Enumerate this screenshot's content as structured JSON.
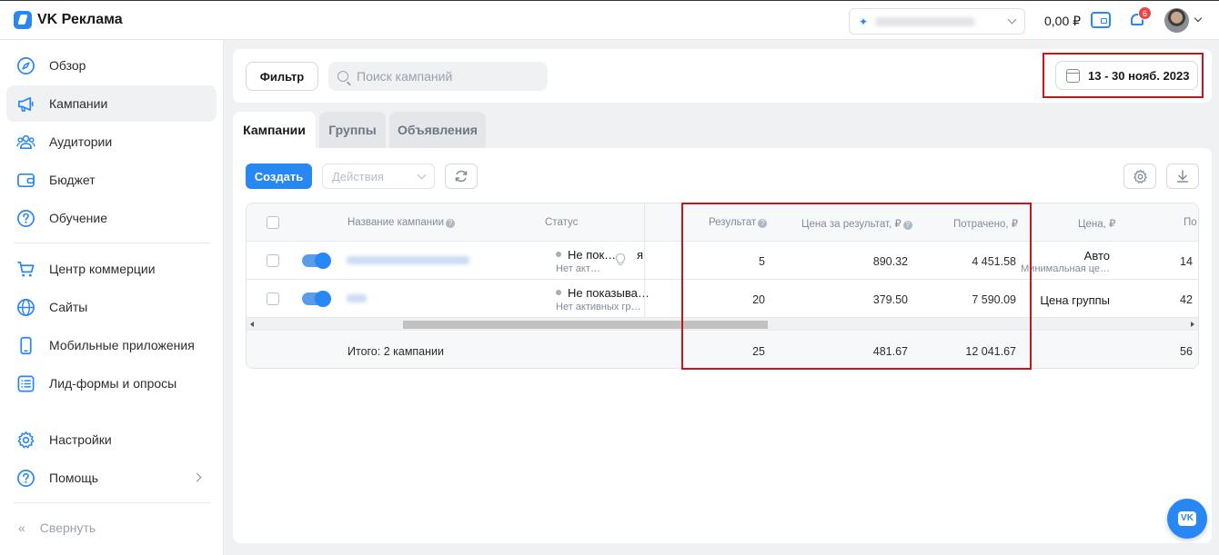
{
  "app": {
    "title": "VK Реклама"
  },
  "topbar": {
    "balance": "0,00 ₽",
    "notifications_count": "6"
  },
  "sidebar": {
    "items": [
      {
        "label": "Обзор",
        "icon": "compass-icon"
      },
      {
        "label": "Кампании",
        "icon": "megaphone-icon",
        "active": true
      },
      {
        "label": "Аудитории",
        "icon": "users-icon"
      },
      {
        "label": "Бюджет",
        "icon": "wallet-icon"
      },
      {
        "label": "Обучение",
        "icon": "question-icon"
      },
      {
        "label": "Центр коммерции",
        "icon": "cart-icon"
      },
      {
        "label": "Сайты",
        "icon": "globe-icon"
      },
      {
        "label": "Мобильные приложения",
        "icon": "smartphone-icon"
      },
      {
        "label": "Лид-формы и опросы",
        "icon": "list-icon"
      },
      {
        "label": "Настройки",
        "icon": "gear-icon"
      },
      {
        "label": "Помощь",
        "icon": "question-icon"
      }
    ],
    "collapse_label": "Свернуть"
  },
  "filterbar": {
    "filter_label": "Фильтр",
    "search_placeholder": "Поиск кампаний",
    "date_range": "13 - 30 нояб. 2023"
  },
  "tabs": [
    {
      "label": "Кампании",
      "active": true
    },
    {
      "label": "Группы",
      "active": false
    },
    {
      "label": "Объявления",
      "active": false
    }
  ],
  "toolbar": {
    "create_label": "Создать",
    "actions_label": "Действия"
  },
  "table": {
    "columns": {
      "name": "Название кампании",
      "status": "Статус",
      "result": "Результат",
      "cost_per_result": "Цена за результат, ₽",
      "spent": "Потрачено, ₽",
      "price": "Цена, ₽",
      "next": "По"
    },
    "rows": [
      {
        "status": "Не пок…",
        "status_sub": "Нет акт…",
        "status_tail": "я",
        "result": "5",
        "cost_per_result": "890.32",
        "spent": "4 451.58",
        "price": "Авто",
        "price_sub": "Минимальная це…",
        "next": "14"
      },
      {
        "status": "Не показыва…",
        "status_sub": "Нет активных гр…",
        "result": "20",
        "cost_per_result": "379.50",
        "spent": "7 590.09",
        "price": "Цена группы",
        "next": "42"
      }
    ],
    "total": {
      "label": "Итого: 2 кампании",
      "result": "25",
      "cost_per_result": "481.67",
      "spent": "12 041.67",
      "next": "56"
    }
  },
  "colors": {
    "accent": "#2787f5",
    "highlight": "#c4161c"
  }
}
